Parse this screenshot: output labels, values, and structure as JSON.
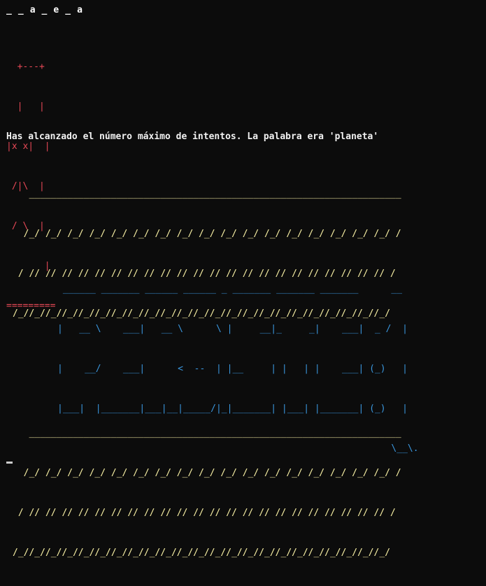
{
  "terminal": {
    "word_progress": "_ _ a _ e _ a",
    "gallows_lines": [
      "  +---+",
      "  |   |",
      "|x x|  |",
      " /|\\  |",
      " / \\  |",
      "       |",
      "========="
    ],
    "message": "Has alcanzado el número máximo de intentos. La palabra era 'planeta'",
    "banner_top_lines": [
      "   ____________________________________________________________________",
      "  /_/ /_/ /_/ /_/ /_/ /_/ /_/ /_/ /_/ /_/ /_/ /_/ /_/ /_/ /_/ /_/ /_/ /",
      " / // // // // // // // // // // // // // // // // // // // // // // /",
      "/_//_//_//_//_//_//_//_//_//_//_//_//_//_//_//_//_//_//_//_//_//_//_/"
    ],
    "perdiste_art_lines": [
      " ______ _______ ______ ______ _ _______ _______ _______      __",
      "|   __ \\    ___|   __ \\      \\ |     __|_     _|    ___|  _ /  |",
      "|    __/    ___|      <  --  | |__     | |   | |    ___| (_)   |",
      "|___|  |_______|___|__|_____/|_|_______| |___| |_______| (_)   |",
      "                                                             \\__\\.",
      ""
    ],
    "banner_bottom_lines": [
      "   ____________________________________________________________________",
      "  /_/ /_/ /_/ /_/ /_/ /_/ /_/ /_/ /_/ /_/ /_/ /_/ /_/ /_/ /_/ /_/ /_/ /",
      " / // // // // // // // // // // // // // // // // // // // // // // /",
      "/_//_//_//_//_//_//_//_//_//_//_//_//_//_//_//_//_//_//_//_//_//_//_/"
    ],
    "colors": {
      "background": "#0c0c0c",
      "gallows": "#e74856",
      "banner": "#f9f1a5",
      "art": "#3a96dd",
      "text": "#f2f2f2"
    }
  }
}
